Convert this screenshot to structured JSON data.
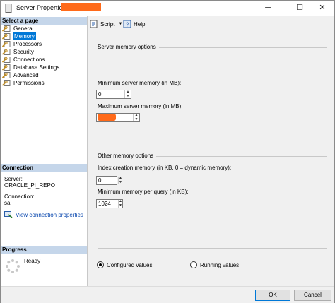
{
  "window": {
    "title": "Server Properties -",
    "minimize_glyph": "─",
    "maximize_glyph": "☐",
    "close_glyph": "✕"
  },
  "left_pane": {
    "select_page_header": "Select a page",
    "pages": [
      {
        "label": "General",
        "icon": "wrench-page-icon",
        "selected": false
      },
      {
        "label": "Memory",
        "icon": "wrench-page-icon",
        "selected": true
      },
      {
        "label": "Processors",
        "icon": "wrench-page-icon",
        "selected": false
      },
      {
        "label": "Security",
        "icon": "wrench-page-icon",
        "selected": false
      },
      {
        "label": "Connections",
        "icon": "wrench-page-icon",
        "selected": false
      },
      {
        "label": "Database Settings",
        "icon": "wrench-page-icon",
        "selected": false
      },
      {
        "label": "Advanced",
        "icon": "wrench-page-icon",
        "selected": false
      },
      {
        "label": "Permissions",
        "icon": "wrench-page-icon",
        "selected": false
      }
    ],
    "connection_header": "Connection",
    "server_label": "Server:",
    "server_value": "ORACLE_PI_REPO",
    "connection_label": "Connection:",
    "connection_value": "sa",
    "view_connection_link": "View connection properties",
    "progress_header": "Progress",
    "progress_status": "Ready"
  },
  "toolbar": {
    "script_label": "Script",
    "help_label": "Help"
  },
  "main": {
    "server_memory_group": "Server memory options",
    "min_memory_label": "Minimum server memory (in MB):",
    "min_memory_value": "0",
    "max_memory_label": "Maximum server memory (in MB):",
    "max_memory_value": "",
    "other_memory_group": "Other memory options",
    "index_memory_label": "Index creation memory (in KB, 0 = dynamic memory):",
    "index_memory_value": "0",
    "min_query_label": "Minimum memory per query (in KB):",
    "min_query_value": "1024",
    "configured_values_label": "Configured values",
    "running_values_label": "Running values",
    "selected_view": "configured"
  },
  "buttons": {
    "ok": "OK",
    "cancel": "Cancel"
  },
  "colors": {
    "selection": "#0078d7",
    "section_header": "#c5d6ea",
    "redaction": "#ff6a1a",
    "link": "#0645ad"
  }
}
